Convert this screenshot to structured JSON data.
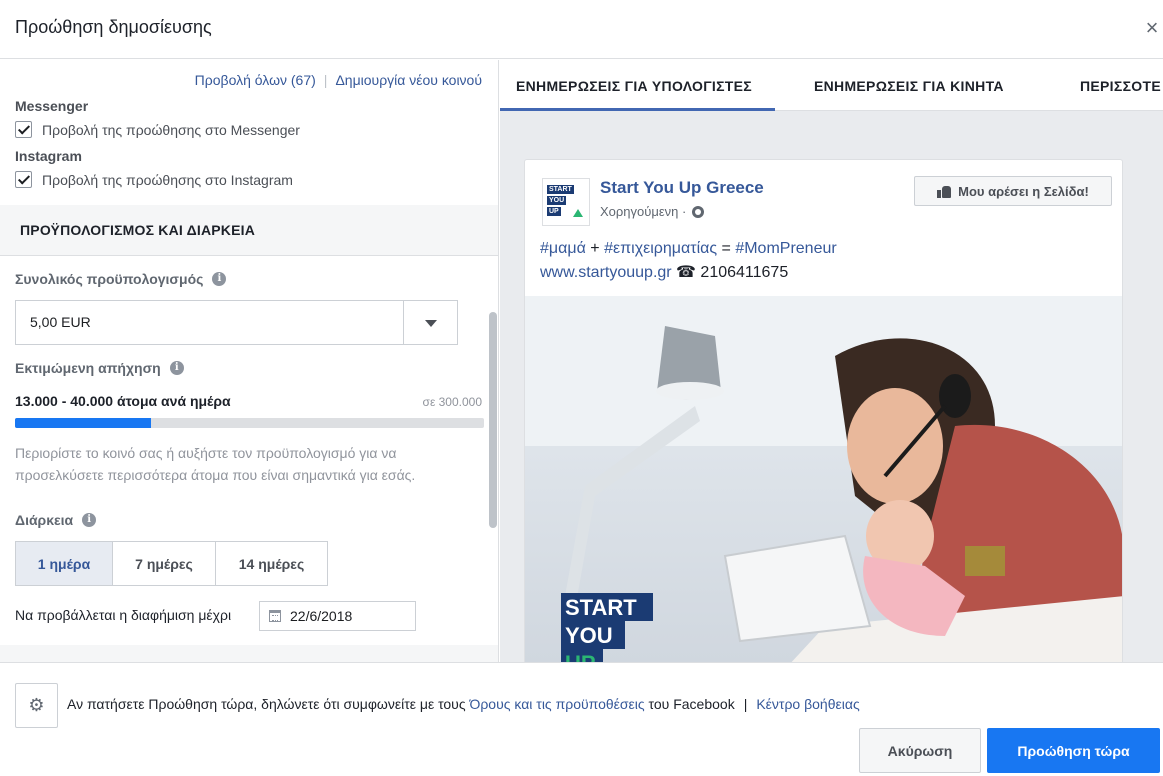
{
  "header": {
    "title": "Προώθηση δημοσίευσης",
    "close": "×"
  },
  "audience_links": {
    "view_all": "Προβολή όλων (67)",
    "create_new": "Δημιουργία νέου κοινού",
    "separator": "|"
  },
  "placements": {
    "messenger": {
      "label": "Messenger",
      "checkbox": "Προβολή της προώθησης στο Messenger",
      "checked": true
    },
    "instagram": {
      "label": "Instagram",
      "checkbox": "Προβολή της προώθησης στο Instagram",
      "checked": true
    }
  },
  "budget_section": {
    "title": "ΠΡΟΫΠΟΛΟΓΙΣΜΟΣ ΚΑΙ ΔΙΑΡΚΕΙΑ",
    "total_budget_label": "Συνολικός προϋπολογισμός",
    "total_budget_value": "5,00 EUR",
    "reach_label": "Εκτιμώμενη απήχηση",
    "reach_range": "13.000 - 40.000 άτομα ανά ημέρα",
    "reach_total": "σε 300.000",
    "reach_fraction": 0.29,
    "reach_note": "Περιορίστε το κοινό σας ή αυξήστε τον προϋπολογισμό για να προσελκύσετε περισσότερα άτομα που είναι σημαντικά για εσάς.",
    "duration_label": "Διάρκεια",
    "durations": [
      "1 ημέρα",
      "7 ημέρες",
      "14 ημέρες"
    ],
    "selected_duration": "1 ημέρα",
    "end_date_label": "Να προβάλλεται η διαφήμιση μέχρι",
    "end_date": "22/6/2018",
    "info_glyph": "i"
  },
  "preview_tabs": [
    "ΕΝΗΜΕΡΩΣΕΙΣ ΓΙΑ ΥΠΟΛΟΓΙΣΤΕΣ",
    "ΕΝΗΜΕΡΩΣΕΙΣ ΓΙΑ ΚΙΝΗΤΑ",
    "ΠΕΡΙΣΣΟΤΕ"
  ],
  "post": {
    "page_name": "Start You Up Greece",
    "sponsored": "Χορηγούμενη ·",
    "like_button": "Μου αρέσει η Σελίδα!",
    "line1": {
      "tag1": "#μαμά",
      "plus": " + ",
      "tag2": "#επιχειρηματίας",
      "eq": " = ",
      "tag3": "#MomPreneur"
    },
    "line2": {
      "url": "www.startyouup.gr",
      "phone": " ☎ 2106411675"
    },
    "logo_lines": [
      "START",
      "YOU",
      "UP"
    ]
  },
  "footer": {
    "terms_prefix": "Αν πατήσετε Προώθηση τώρα, δηλώνετε ότι συμφωνείτε με τους ",
    "terms_link": "Όρους και τις προϋποθέσεις",
    "terms_suffix": " του Facebook",
    "separator": "|",
    "help_link": "Κέντρο βοήθειας",
    "cancel": "Ακύρωση",
    "boost": "Προώθηση τώρα",
    "gear_glyph": "⚙"
  },
  "colors": {
    "primary": "#1877f2",
    "link": "#365899",
    "logo_navy": "#1b3b73",
    "logo_green": "#2bb673"
  }
}
